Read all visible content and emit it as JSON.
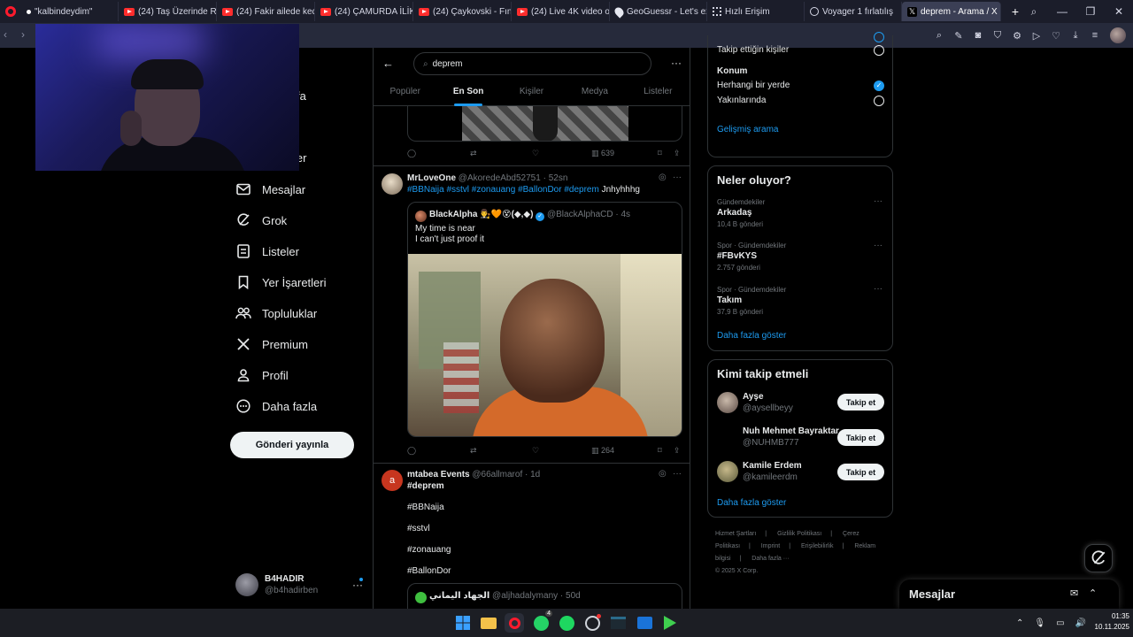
{
  "browser": {
    "tabs": [
      {
        "label": "\"kalbindeydim\"",
        "favicon": "dot-icon"
      },
      {
        "label": "(24) Taş Üzerinde Rulo Kö",
        "favicon": "youtube-icon"
      },
      {
        "label": "(24) Fakir ailede kedi olm",
        "favicon": "youtube-icon"
      },
      {
        "label": "(24) ÇAMURDA İLİKLİ DAI",
        "favicon": "youtube-icon"
      },
      {
        "label": "(24) Çaykovski - Fındıkkır",
        "favicon": "youtube-icon"
      },
      {
        "label": "(24) Live 4K video of Earth",
        "favicon": "youtube-icon"
      },
      {
        "label": "GeoGuessr - Let's explore",
        "favicon": "geo-pin-icon"
      },
      {
        "label": "Hızlı Erişim",
        "favicon": "grid-icon"
      },
      {
        "label": "Voyager 1 fırlatılış",
        "favicon": "globe-icon"
      },
      {
        "label": "deprem - Arama / X",
        "favicon": "x-icon",
        "active": true
      }
    ]
  },
  "sidebar": {
    "partial_item_1": "fa",
    "partial_item_2": "ler",
    "items": [
      {
        "label": "Mesajlar",
        "icon": "mail-icon"
      },
      {
        "label": "Grok",
        "icon": "grok-icon"
      },
      {
        "label": "Listeler",
        "icon": "list-icon"
      },
      {
        "label": "Yer İşaretleri",
        "icon": "bookmark-icon"
      },
      {
        "label": "Topluluklar",
        "icon": "communities-icon"
      },
      {
        "label": "Premium",
        "icon": "x-logo-icon"
      },
      {
        "label": "Profil",
        "icon": "profile-icon"
      },
      {
        "label": "Daha fazla",
        "icon": "more-circle-icon"
      }
    ],
    "post_button": "Gönderi yayınla",
    "account": {
      "name": "B4HADIR",
      "handle": "@b4hadirben"
    }
  },
  "search": {
    "query": "deprem",
    "tabs": [
      "Popüler",
      "En Son",
      "Kişiler",
      "Medya",
      "Listeler"
    ],
    "active_tab": "En Son"
  },
  "feed": {
    "first_post_views": "639",
    "post1": {
      "name": "MrLoveOne",
      "handle": "@AkoredeAbd52751",
      "time": "52sn",
      "hashtags": "#BBNaija #sstvl #zonauang #BallonDor #deprem",
      "text": "Jnhyhhhg",
      "quote": {
        "name": "BlackAlpha",
        "emojis": "👨‍⚖️🧡😵(◆,◆)",
        "handle": "@BlackAlphaCD",
        "time": "4s",
        "line1": "My time is near",
        "line2": "I can't just proof it"
      },
      "views": "264"
    },
    "post2": {
      "avatar_letter": "a",
      "name": "mtabea Events",
      "handle": "@66allmarof",
      "time": "1d",
      "lines": [
        "#deprem",
        "#BBNaija",
        "#sstvl",
        "#zonauang",
        "#BallonDor"
      ],
      "quote": {
        "name": "الجهاد اليماني",
        "handle": "@aljhadalymany",
        "time": "50d"
      }
    }
  },
  "right": {
    "filters": {
      "takip_label": "Takip ettiğin kişiler",
      "location_title": "Konum",
      "anywhere": "Herhangi bir yerde",
      "nearby": "Yakınlarında",
      "advanced": "Gelişmiş arama"
    },
    "trends": {
      "title": "Neler oluyor?",
      "items": [
        {
          "meta": "Gündemdekiler",
          "name": "Arkadaş",
          "count": "10,4 B gönderi"
        },
        {
          "meta": "Spor · Gündemdekiler",
          "name": "#FBvKYS",
          "count": "2.757 gönderi"
        },
        {
          "meta": "Spor · Gündemdekiler",
          "name": "Takım",
          "count": "37,9 B gönderi"
        }
      ],
      "more": "Daha fazla göster"
    },
    "who_to_follow": {
      "title": "Kimi takip etmeli",
      "users": [
        {
          "name": "Ayşe",
          "handle": "@aysellbeyy"
        },
        {
          "name": "Nuh Mehmet Bayraktar",
          "handle": "@NUHMB777"
        },
        {
          "name": "Kamile Erdem",
          "handle": "@kamileerdm"
        }
      ],
      "follow_label": "Takip et",
      "more": "Daha fazla göster"
    },
    "footer": [
      "Hizmet Şartları",
      "Gizlilik Politikası",
      "Çerez Politikası",
      "Imprint",
      "Erişilebilirlik",
      "Reklam bilgisi",
      "Daha fazla ···",
      "© 2025 X Corp."
    ],
    "messages_drawer": "Mesajlar"
  },
  "taskbar": {
    "time": "01:35",
    "date": "10.11.2025",
    "whatsapp_badge": "4"
  },
  "colors": {
    "accent": "#1d9bf0",
    "background": "#000000",
    "border": "#2f3336"
  }
}
